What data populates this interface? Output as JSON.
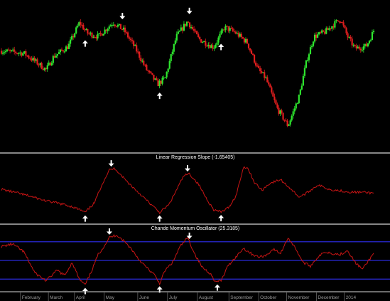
{
  "colors": {
    "background": "#000000",
    "up_candle": "#2ee62e",
    "down_candle": "#e01e1e",
    "indicator_line": "#c81414",
    "reference_line": "#2a2ad8",
    "panel_divider": "#d8d8d8",
    "arrow": "#ffffff",
    "axis_text": "#9a9a9a"
  },
  "chart_data": [
    {
      "type": "candlestick",
      "title": "",
      "price_path": [
        [
          0,
          0.68
        ],
        [
          6,
          0.66
        ],
        [
          10,
          0.57
        ],
        [
          12,
          0.52
        ],
        [
          14,
          0.63
        ],
        [
          18,
          0.72
        ],
        [
          21,
          0.92
        ],
        [
          23,
          0.83
        ],
        [
          26,
          0.8
        ],
        [
          30,
          0.92
        ],
        [
          33,
          0.85
        ],
        [
          36,
          0.7
        ],
        [
          39,
          0.52
        ],
        [
          42,
          0.4
        ],
        [
          44,
          0.45
        ],
        [
          47,
          0.8
        ],
        [
          50,
          0.93
        ],
        [
          53,
          0.78
        ],
        [
          57,
          0.71
        ],
        [
          60,
          0.88
        ],
        [
          63,
          0.83
        ],
        [
          66,
          0.75
        ],
        [
          69,
          0.52
        ],
        [
          71,
          0.45
        ],
        [
          74,
          0.2
        ],
        [
          77,
          0.05
        ],
        [
          80,
          0.3
        ],
        [
          82,
          0.6
        ],
        [
          84,
          0.8
        ],
        [
          87,
          0.84
        ],
        [
          91,
          0.95
        ],
        [
          93,
          0.8
        ],
        [
          95,
          0.7
        ],
        [
          98,
          0.72
        ],
        [
          99,
          0.78
        ],
        [
          100,
          0.85
        ]
      ],
      "highs": [
        {
          "t": 32.5,
          "label": "↓"
        },
        {
          "t": 50.5,
          "label": "↓"
        }
      ],
      "lows": [
        {
          "t": 22.5,
          "label": "↑"
        },
        {
          "t": 42.5,
          "label": "↑"
        },
        {
          "t": 59,
          "label": "↑"
        }
      ]
    },
    {
      "type": "line",
      "title": "Linear Regression Slope (-1.65405)",
      "series": [
        {
          "values": [
            [
              0,
              0.5
            ],
            [
              4,
              0.43
            ],
            [
              8,
              0.35
            ],
            [
              12,
              0.26
            ],
            [
              16,
              0.2
            ],
            [
              19,
              0.14
            ],
            [
              21,
              0.08
            ],
            [
              22.5,
              0.02
            ],
            [
              25,
              0.22
            ],
            [
              27,
              0.6
            ],
            [
              29,
              0.9
            ],
            [
              30.5,
              0.93
            ],
            [
              34,
              0.64
            ],
            [
              37,
              0.42
            ],
            [
              40,
              0.2
            ],
            [
              42.5,
              0.02
            ],
            [
              45,
              0.18
            ],
            [
              47,
              0.48
            ],
            [
              49,
              0.78
            ],
            [
              50.5,
              0.82
            ],
            [
              53,
              0.6
            ],
            [
              55,
              0.32
            ],
            [
              57,
              0.08
            ],
            [
              59,
              0.03
            ],
            [
              61,
              0.12
            ],
            [
              63,
              0.36
            ],
            [
              65,
              0.95
            ],
            [
              66,
              0.96
            ],
            [
              68,
              0.64
            ],
            [
              70,
              0.48
            ],
            [
              72,
              0.62
            ],
            [
              75,
              0.7
            ],
            [
              78,
              0.49
            ],
            [
              80,
              0.34
            ],
            [
              82,
              0.42
            ],
            [
              85,
              0.59
            ],
            [
              88,
              0.5
            ],
            [
              91,
              0.47
            ],
            [
              94,
              0.44
            ],
            [
              97,
              0.44
            ],
            [
              100,
              0.42
            ]
          ]
        }
      ],
      "highs": [
        {
          "t": 29.5,
          "label": "↓"
        },
        {
          "t": 50,
          "label": "↓"
        }
      ],
      "lows": [
        {
          "t": 22.5,
          "label": "↑"
        },
        {
          "t": 42.5,
          "label": "↑"
        },
        {
          "t": 59,
          "label": "↑"
        }
      ]
    },
    {
      "type": "line",
      "title": "Chande Momentum Oscillator (25.3185)",
      "ylim": [
        -80,
        80
      ],
      "reference_lines": [
        50,
        0,
        -50
      ],
      "series": [
        {
          "values": [
            [
              0,
              0.75
            ],
            [
              3,
              0.8
            ],
            [
              6,
              0.65
            ],
            [
              9,
              0.25
            ],
            [
              12,
              0.1
            ],
            [
              15,
              0.3
            ],
            [
              17,
              0.2
            ],
            [
              19,
              0.45
            ],
            [
              21,
              0.12
            ],
            [
              22.5,
              0.02
            ],
            [
              24,
              0.25
            ],
            [
              26,
              0.6
            ],
            [
              27.5,
              0.75
            ],
            [
              29,
              0.92
            ],
            [
              31,
              0.97
            ],
            [
              33,
              0.85
            ],
            [
              35,
              0.7
            ],
            [
              37,
              0.5
            ],
            [
              39,
              0.35
            ],
            [
              41,
              0.22
            ],
            [
              42.5,
              0.05
            ],
            [
              44,
              0.3
            ],
            [
              46,
              0.45
            ],
            [
              48,
              0.75
            ],
            [
              50,
              0.92
            ],
            [
              52,
              0.6
            ],
            [
              54,
              0.35
            ],
            [
              56,
              0.25
            ],
            [
              57.5,
              0.08
            ],
            [
              59,
              0.1
            ],
            [
              61,
              0.4
            ],
            [
              63,
              0.55
            ],
            [
              65,
              0.72
            ],
            [
              67,
              0.62
            ],
            [
              69,
              0.55
            ],
            [
              71,
              0.58
            ],
            [
              73,
              0.7
            ],
            [
              75,
              0.62
            ],
            [
              77,
              0.92
            ],
            [
              79,
              0.72
            ],
            [
              81,
              0.45
            ],
            [
              83,
              0.38
            ],
            [
              85,
              0.55
            ],
            [
              87,
              0.65
            ],
            [
              89,
              0.62
            ],
            [
              91,
              0.6
            ],
            [
              93,
              0.68
            ],
            [
              95,
              0.45
            ],
            [
              97,
              0.32
            ],
            [
              99,
              0.52
            ],
            [
              100,
              0.62
            ]
          ]
        }
      ],
      "highs": [
        {
          "t": 29,
          "label": "↓"
        },
        {
          "t": 50.5,
          "label": "↓"
        }
      ],
      "lows": [
        {
          "t": 22.5,
          "label": "↑"
        },
        {
          "t": 42.5,
          "label": "↑"
        },
        {
          "t": 58,
          "label": "↑"
        }
      ]
    }
  ],
  "time_axis": {
    "labels": [
      {
        "t": 5.5,
        "label": "February"
      },
      {
        "t": 13,
        "label": "March"
      },
      {
        "t": 20,
        "label": "April"
      },
      {
        "t": 28,
        "label": "May"
      },
      {
        "t": 37,
        "label": "June"
      },
      {
        "t": 45,
        "label": "July"
      },
      {
        "t": 53,
        "label": "August"
      },
      {
        "t": 61.5,
        "label": "September"
      },
      {
        "t": 69.5,
        "label": "October"
      },
      {
        "t": 77,
        "label": "November"
      },
      {
        "t": 85,
        "label": "December"
      },
      {
        "t": 92.5,
        "label": "2014"
      }
    ]
  }
}
